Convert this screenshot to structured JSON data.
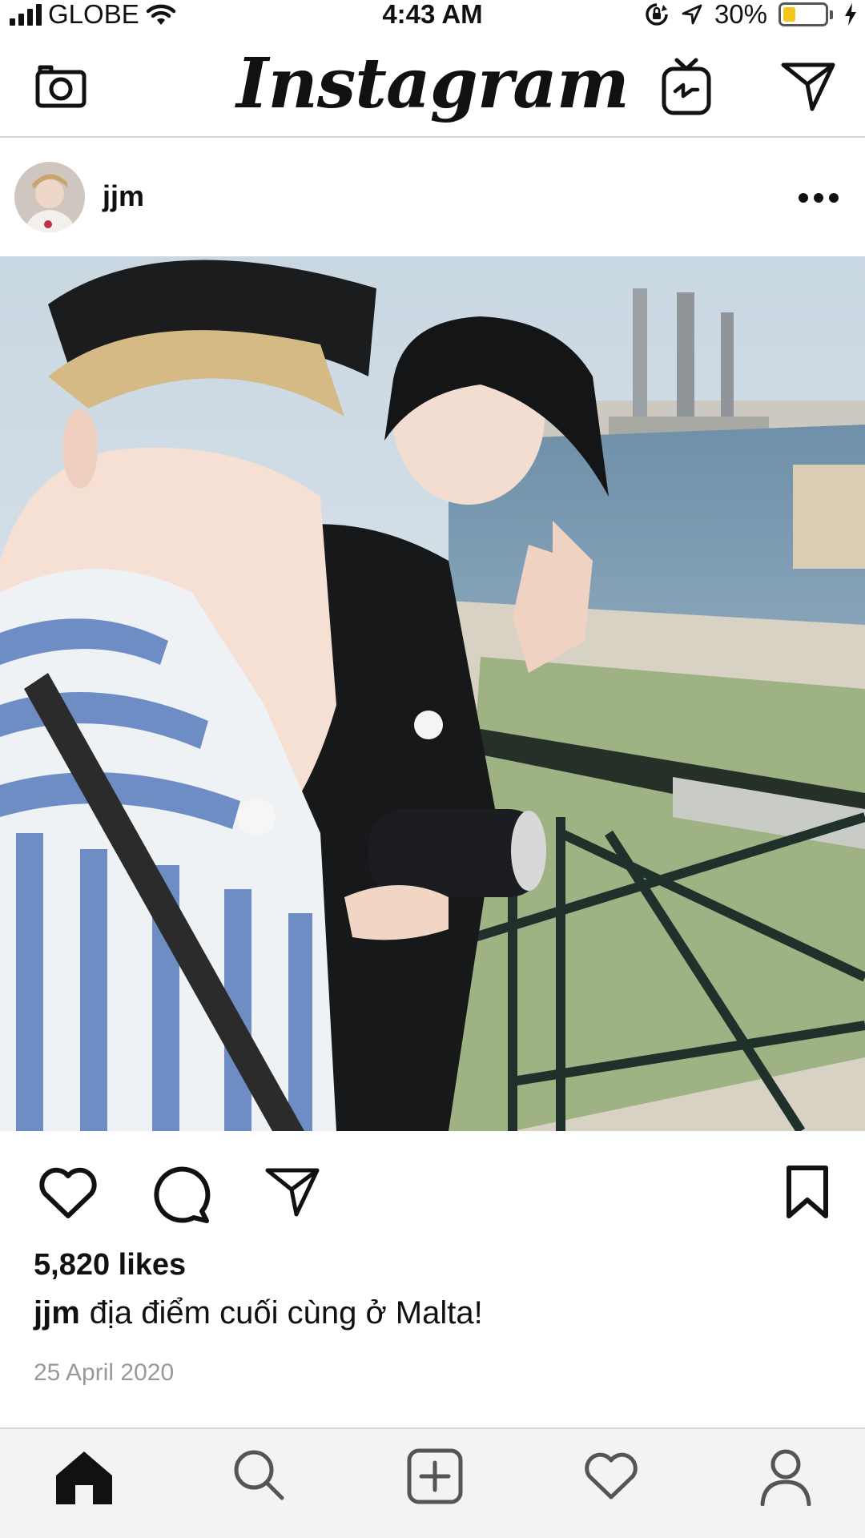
{
  "status_bar": {
    "carrier": "GLOBE",
    "time": "4:43 AM",
    "battery_percent": "30%",
    "battery_level": 0.3,
    "battery_color": "#f5c518"
  },
  "header": {
    "logo_text": "Instagram",
    "icons": [
      "camera-icon",
      "igtv-icon",
      "direct-message-icon"
    ]
  },
  "post": {
    "username": "jjm",
    "more_icon": "more-options-icon",
    "likes": "5,820 likes",
    "caption_user": "jjm",
    "caption_text": "địa điểm cuối cùng ở Malta!",
    "date": "25 April 2020",
    "actions": [
      "like-icon",
      "comment-icon",
      "share-icon",
      "bookmark-icon"
    ]
  },
  "tab_bar": {
    "items": [
      "home-icon",
      "search-icon",
      "new-post-icon",
      "activity-icon",
      "profile-icon"
    ],
    "active": "home-icon"
  },
  "colors": {
    "text": "#111111",
    "muted": "#999999",
    "divider": "#d6d6d6",
    "tab_bg": "#f3f3f6"
  }
}
